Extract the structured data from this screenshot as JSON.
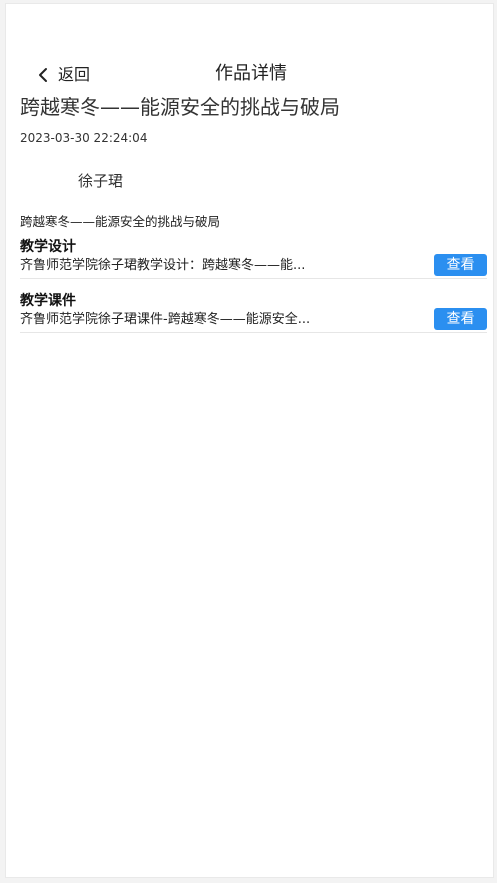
{
  "header": {
    "back_label": "返回",
    "page_title": "作品详情"
  },
  "work": {
    "title": "跨越寒冬——能源安全的挑战与破局",
    "timestamp": "2023-03-30 22:24:04",
    "author": "徐子珺",
    "sub_title": "跨越寒冬——能源安全的挑战与破局"
  },
  "resources": [
    {
      "label": "教学设计",
      "name": "齐鲁师范学院徐子珺教学设计：跨越寒冬——能...",
      "button_label": "查看"
    },
    {
      "label": "教学课件",
      "name": "齐鲁师范学院徐子珺课件-跨越寒冬——能源安全...",
      "button_label": "查看"
    }
  ],
  "colors": {
    "accent": "#2b8ff0",
    "text": "#222222",
    "background": "#ffffff"
  }
}
